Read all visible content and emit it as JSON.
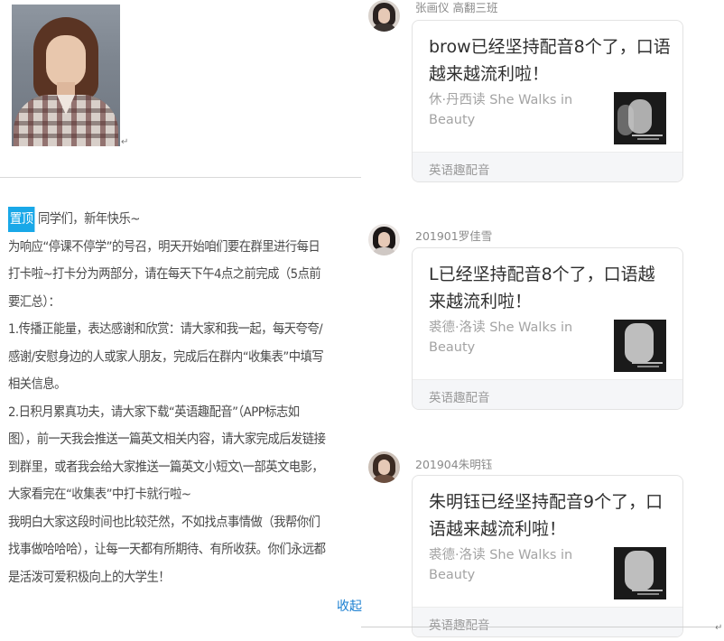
{
  "photo": {
    "description_icon": "user-photo"
  },
  "announcement": {
    "pin_label": "置顶",
    "paragraphs": [
      "同学们，新年快乐~",
      "为响应“停课不停学”的号召，明天开始咱们要在群里进行每日打卡啦~打卡分为两部分，请在每天下午4点之前完成（5点前要汇总）：",
      "1.传播正能量，表达感谢和欣赏：请大家和我一起，每天夸夸/感谢/安慰身边的人或家人朋友，完成后在群内“收集表”中填写相关信息。",
      "2.日积月累真功夫，请大家下载“英语趣配音”（APP标志如图），前一天我会推送一篇英文相关内容，请大家完成后发链接到群里，或者我会给大家推送一篇英文小短文\\一部英文电影，大家看完在“收集表”中打卡就行啦~",
      "我明白大家这段时间也比较茫然，不如找点事情做（我帮你们找事做哈哈哈），让每一天都有所期待、有所收获。你们永远都是活泼可爱积极向上的大学生！"
    ],
    "more_link": "收起"
  },
  "feed": [
    {
      "username": "张画仪 高翻三班",
      "headline": "brow已经坚持配音8个了，口语越来越流利啦！",
      "subtitle": "休·丹西读 She Walks in Beauty",
      "footer": "英语趣配音"
    },
    {
      "username": "201901罗佳雪",
      "headline": "L已经坚持配音8个了，口语越来越流利啦！",
      "subtitle": "裘德·洛读 She Walks in Beauty",
      "footer": "英语趣配音"
    },
    {
      "username": "201904朱明钰",
      "headline": "朱明钰已经坚持配音9个了，口语越来越流利啦！",
      "subtitle": "裘德·洛读 She Walks in Beauty",
      "footer": "英语趣配音"
    }
  ],
  "marks": {
    "return_mark": "↵"
  },
  "colors": {
    "pin_badge": "#19a8e8",
    "link": "#1a7fd1",
    "card_footer_bg": "#f5f6f8"
  }
}
